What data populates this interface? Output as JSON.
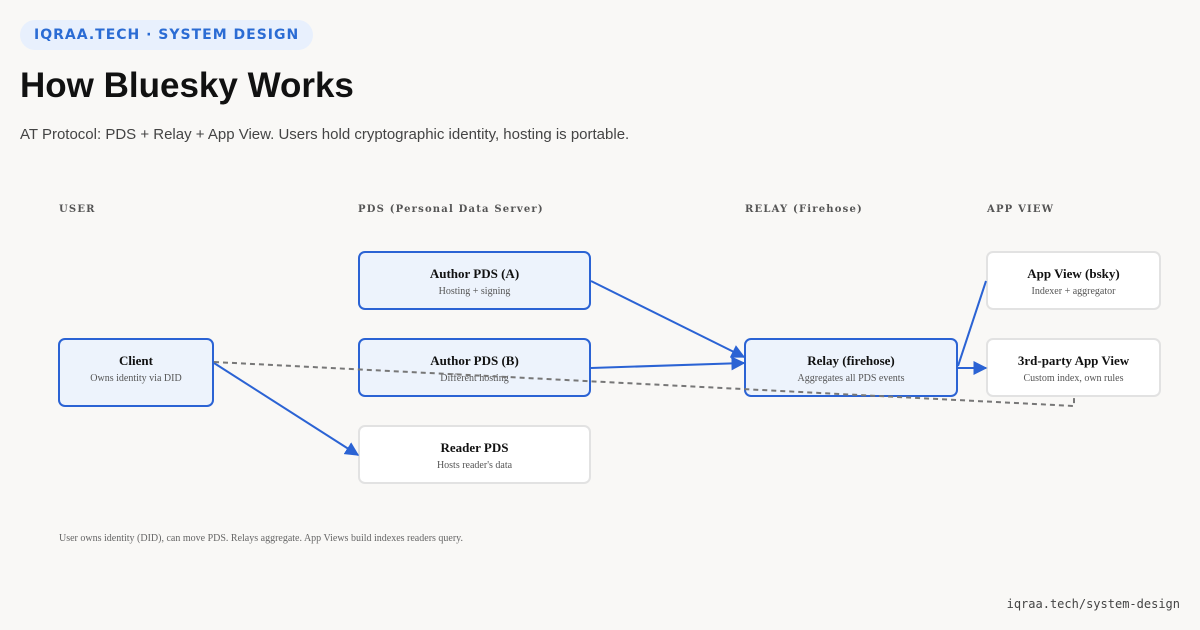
{
  "header": {
    "badge": "IQRAA.TECH · SYSTEM DESIGN",
    "title": "How Bluesky Works",
    "subtitle": "AT Protocol: PDS + Relay + App View. Users hold cryptographic identity, hosting is portable."
  },
  "columns": {
    "user": "USER",
    "pds": "PDS (Personal Data Server)",
    "relay": "RELAY (Firehose)",
    "appview": "APP VIEW"
  },
  "nodes": {
    "client": {
      "title": "Client",
      "sub": "Owns identity via DID"
    },
    "author_a": {
      "title": "Author PDS (A)",
      "sub": "Hosting + signing"
    },
    "author_b": {
      "title": "Author PDS (B)",
      "sub": "Different hosting"
    },
    "reader": {
      "title": "Reader PDS",
      "sub": "Hosts reader's data"
    },
    "relay": {
      "title": "Relay (firehose)",
      "sub": "Aggregates all PDS events"
    },
    "appview_bsky": {
      "title": "App View (bsky)",
      "sub": "Indexer + aggregator"
    },
    "appview_3p": {
      "title": "3rd-party App View",
      "sub": "Custom index, own rules"
    }
  },
  "colors": {
    "accent": "#2b63d4",
    "dashed": "#777777"
  },
  "note": "User owns identity (DID), can move PDS. Relays aggregate. App Views build indexes readers query.",
  "footer": "iqraa.tech/system-design"
}
